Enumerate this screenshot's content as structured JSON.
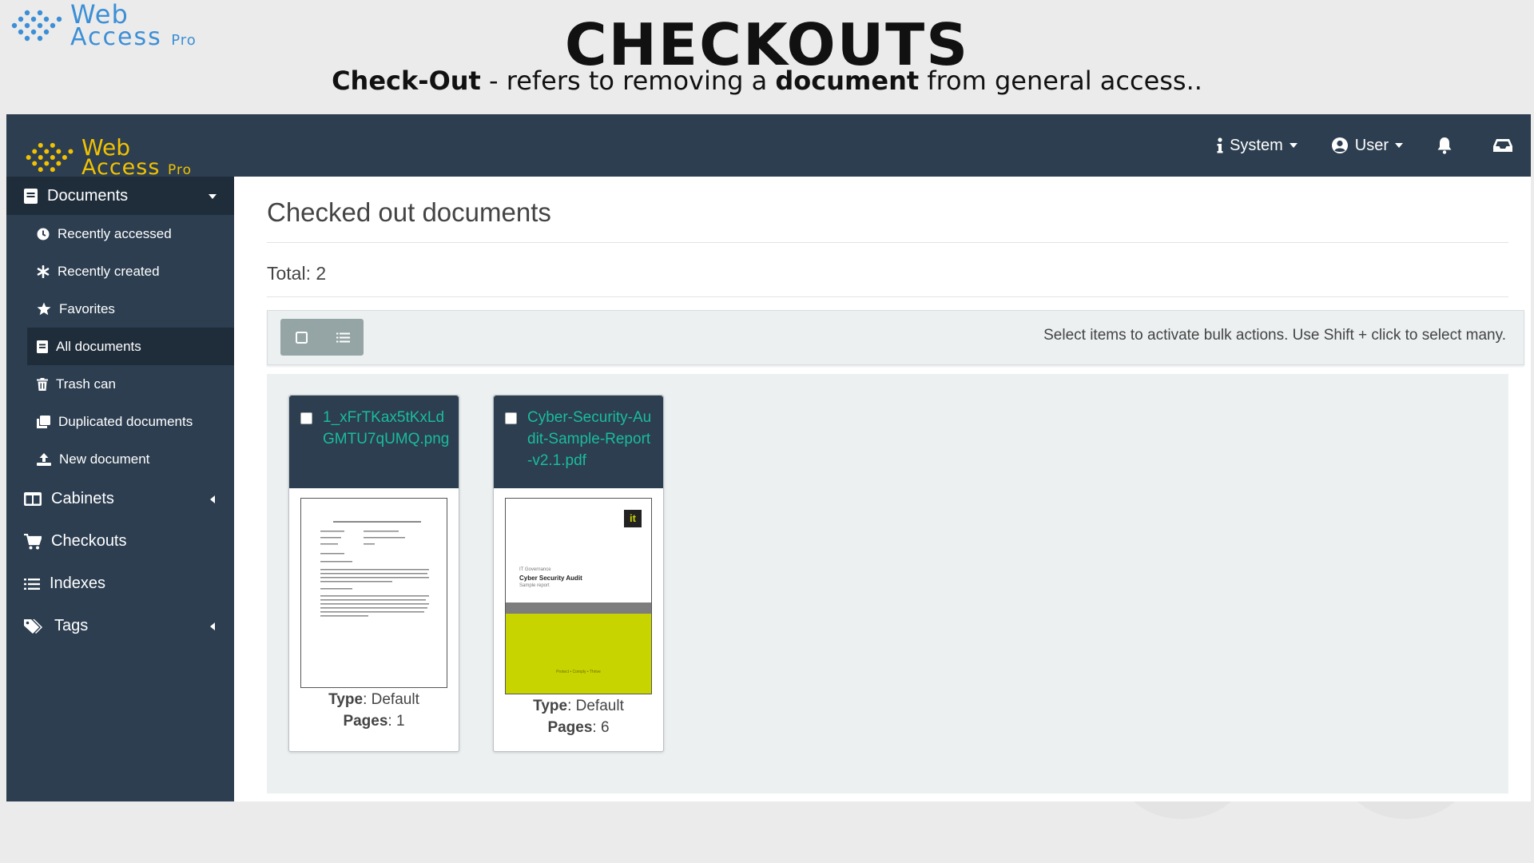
{
  "slide": {
    "logo_line1": "Web",
    "logo_line2": "Access",
    "logo_pro": "Pro",
    "title": "CHECKOUTS",
    "subtitle_bold1": "Check-Out",
    "subtitle_part1": " - refers to removing a ",
    "subtitle_bold2": "document",
    "subtitle_part2": " from general access.."
  },
  "app": {
    "logo_line1": "Web",
    "logo_line2": "Access",
    "logo_pro": "Pro",
    "topnav": {
      "system_label": "System",
      "user_label": "User"
    }
  },
  "sidebar": {
    "documents_label": "Documents",
    "documents_items": [
      {
        "label": "Recently accessed",
        "icon": "clock-icon"
      },
      {
        "label": "Recently created",
        "icon": "asterisk-icon"
      },
      {
        "label": "Favorites",
        "icon": "star-icon"
      },
      {
        "label": "All documents",
        "icon": "document-icon"
      },
      {
        "label": "Trash can",
        "icon": "trash-icon"
      },
      {
        "label": "Duplicated documents",
        "icon": "copy-icon"
      },
      {
        "label": "New document",
        "icon": "upload-icon"
      }
    ],
    "main_items": [
      {
        "label": "Cabinets",
        "icon": "columns-icon"
      },
      {
        "label": "Checkouts",
        "icon": "cart-icon"
      },
      {
        "label": "Indexes",
        "icon": "list-icon"
      },
      {
        "label": "Tags",
        "icon": "tags-icon"
      }
    ]
  },
  "content": {
    "page_title": "Checked out documents",
    "total": "Total: 2",
    "bulk_hint": "Select items to activate bulk actions. Use Shift + click to select many.",
    "documents": [
      {
        "filename": "1_xFrTKax5tKxLdGMTU7qUMQ.png",
        "type_label": "Type",
        "type_value": "Default",
        "pages_label": "Pages",
        "pages_value": "1"
      },
      {
        "filename": "Cyber-Security-Audit-Sample-Report-v2.1.pdf",
        "type_label": "Type",
        "type_value": "Default",
        "pages_label": "Pages",
        "pages_value": "6"
      }
    ],
    "pdf_thumb": {
      "badge": "it",
      "kicker": "IT Governance",
      "title": "Cyber Security Audit",
      "subtitle": "Sample report",
      "footer": "Protect • Comply • Thrive"
    }
  },
  "colors": {
    "navbar": "#2c3e50",
    "sidebar_active": "#1f2d3b",
    "link": "#1abc9c",
    "accent_yellow": "#f2c200",
    "slide_logo_blue": "#3c8fd6",
    "report_green": "#c8d400"
  }
}
